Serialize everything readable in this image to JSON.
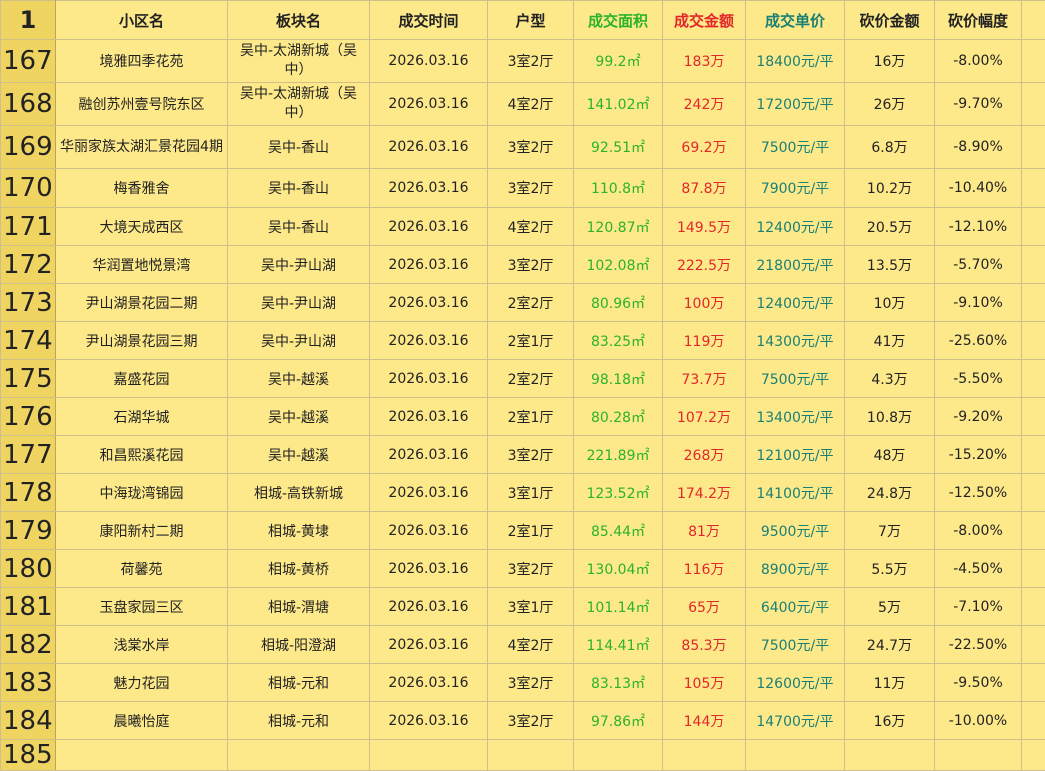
{
  "corner_label": "1",
  "headers": {
    "name": "小区名",
    "area": "板块名",
    "date": "成交时间",
    "type": "户型",
    "sqm": "成交面积",
    "amount": "成交金额",
    "unit": "成交单价",
    "cut": "砍价金额",
    "pct": "砍价幅度"
  },
  "colors": {
    "background": "#fde98a",
    "row_header": "#f0d462",
    "area_green": "#2bb32b",
    "amount_red": "#e3262a",
    "unit_teal": "#1a8075"
  },
  "rows": [
    {
      "rn": "167",
      "name": "境雅四季花苑",
      "area": "吴中-太湖新城（吴中）",
      "date": "2026.03.16",
      "type": "3室2厅",
      "sqm": "99.2㎡",
      "amount": "183万",
      "unit": "18400元/平",
      "cut": "16万",
      "pct": "-8.00%"
    },
    {
      "rn": "168",
      "name": "融创苏州壹号院东区",
      "area": "吴中-太湖新城（吴中）",
      "date": "2026.03.16",
      "type": "4室2厅",
      "sqm": "141.02㎡",
      "amount": "242万",
      "unit": "17200元/平",
      "cut": "26万",
      "pct": "-9.70%"
    },
    {
      "rn": "169",
      "name": "华丽家族太湖汇景花园4期",
      "area": "吴中-香山",
      "date": "2026.03.16",
      "type": "3室2厅",
      "sqm": "92.51㎡",
      "amount": "69.2万",
      "unit": "7500元/平",
      "cut": "6.8万",
      "pct": "-8.90%"
    },
    {
      "rn": "170",
      "name": "梅香雅舍",
      "area": "吴中-香山",
      "date": "2026.03.16",
      "type": "3室2厅",
      "sqm": "110.8㎡",
      "amount": "87.8万",
      "unit": "7900元/平",
      "cut": "10.2万",
      "pct": "-10.40%"
    },
    {
      "rn": "171",
      "name": "大境天成西区",
      "area": "吴中-香山",
      "date": "2026.03.16",
      "type": "4室2厅",
      "sqm": "120.87㎡",
      "amount": "149.5万",
      "unit": "12400元/平",
      "cut": "20.5万",
      "pct": "-12.10%"
    },
    {
      "rn": "172",
      "name": "华润置地悦景湾",
      "area": "吴中-尹山湖",
      "date": "2026.03.16",
      "type": "3室2厅",
      "sqm": "102.08㎡",
      "amount": "222.5万",
      "unit": "21800元/平",
      "cut": "13.5万",
      "pct": "-5.70%"
    },
    {
      "rn": "173",
      "name": "尹山湖景花园二期",
      "area": "吴中-尹山湖",
      "date": "2026.03.16",
      "type": "2室2厅",
      "sqm": "80.96㎡",
      "amount": "100万",
      "unit": "12400元/平",
      "cut": "10万",
      "pct": "-9.10%"
    },
    {
      "rn": "174",
      "name": "尹山湖景花园三期",
      "area": "吴中-尹山湖",
      "date": "2026.03.16",
      "type": "2室1厅",
      "sqm": "83.25㎡",
      "amount": "119万",
      "unit": "14300元/平",
      "cut": "41万",
      "pct": "-25.60%"
    },
    {
      "rn": "175",
      "name": "嘉盛花园",
      "area": "吴中-越溪",
      "date": "2026.03.16",
      "type": "2室2厅",
      "sqm": "98.18㎡",
      "amount": "73.7万",
      "unit": "7500元/平",
      "cut": "4.3万",
      "pct": "-5.50%"
    },
    {
      "rn": "176",
      "name": "石湖华城",
      "area": "吴中-越溪",
      "date": "2026.03.16",
      "type": "2室1厅",
      "sqm": "80.28㎡",
      "amount": "107.2万",
      "unit": "13400元/平",
      "cut": "10.8万",
      "pct": "-9.20%"
    },
    {
      "rn": "177",
      "name": "和昌熙溪花园",
      "area": "吴中-越溪",
      "date": "2026.03.16",
      "type": "3室2厅",
      "sqm": "221.89㎡",
      "amount": "268万",
      "unit": "12100元/平",
      "cut": "48万",
      "pct": "-15.20%"
    },
    {
      "rn": "178",
      "name": "中海珑湾锦园",
      "area": "相城-高铁新城",
      "date": "2026.03.16",
      "type": "3室1厅",
      "sqm": "123.52㎡",
      "amount": "174.2万",
      "unit": "14100元/平",
      "cut": "24.8万",
      "pct": "-12.50%"
    },
    {
      "rn": "179",
      "name": "康阳新村二期",
      "area": "相城-黄埭",
      "date": "2026.03.16",
      "type": "2室1厅",
      "sqm": "85.44㎡",
      "amount": "81万",
      "unit": "9500元/平",
      "cut": "7万",
      "pct": "-8.00%"
    },
    {
      "rn": "180",
      "name": "荷馨苑",
      "area": "相城-黄桥",
      "date": "2026.03.16",
      "type": "3室2厅",
      "sqm": "130.04㎡",
      "amount": "116万",
      "unit": "8900元/平",
      "cut": "5.5万",
      "pct": "-4.50%"
    },
    {
      "rn": "181",
      "name": "玉盘家园三区",
      "area": "相城-渭塘",
      "date": "2026.03.16",
      "type": "3室1厅",
      "sqm": "101.14㎡",
      "amount": "65万",
      "unit": "6400元/平",
      "cut": "5万",
      "pct": "-7.10%"
    },
    {
      "rn": "182",
      "name": "浅棠水岸",
      "area": "相城-阳澄湖",
      "date": "2026.03.16",
      "type": "4室2厅",
      "sqm": "114.41㎡",
      "amount": "85.3万",
      "unit": "7500元/平",
      "cut": "24.7万",
      "pct": "-22.50%"
    },
    {
      "rn": "183",
      "name": "魅力花园",
      "area": "相城-元和",
      "date": "2026.03.16",
      "type": "3室2厅",
      "sqm": "83.13㎡",
      "amount": "105万",
      "unit": "12600元/平",
      "cut": "11万",
      "pct": "-9.50%"
    },
    {
      "rn": "184",
      "name": "晨曦怡庭",
      "area": "相城-元和",
      "date": "2026.03.16",
      "type": "3室2厅",
      "sqm": "97.86㎡",
      "amount": "144万",
      "unit": "14700元/平",
      "cut": "16万",
      "pct": "-10.00%"
    }
  ],
  "next_row_label": "185"
}
